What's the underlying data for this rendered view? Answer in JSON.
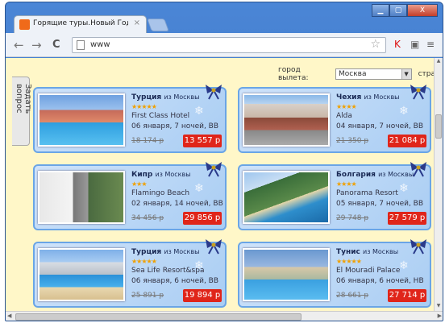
{
  "browser": {
    "tab_title": "Горящие туры.Новый Год!",
    "tab_close": "×",
    "url": "www",
    "nav": {
      "back": "←",
      "forward": "→",
      "reload": "C"
    },
    "window_controls": {
      "minimize": "▁",
      "maximize": "▢",
      "close": "X"
    }
  },
  "page": {
    "city_label": "город вылета:",
    "city_value": "Москва",
    "country_label": "стра",
    "ask_question": "Задать вопрос"
  },
  "tours": [
    {
      "country": "Турция",
      "from": "из Москвы",
      "stars": "★★★★★",
      "hotel": "First Class Hotel",
      "dates": "06 января, 7 ночей, BB",
      "old_price": "18 174 р",
      "price": "13 557 р"
    },
    {
      "country": "Чехия",
      "from": "из Москвы",
      "stars": "★★★★",
      "hotel": "Alda",
      "dates": "04 января, 7 ночей, BB",
      "old_price": "21 350 р",
      "price": "21 084 р"
    },
    {
      "country": "Кипр",
      "from": "из Москвы",
      "stars": "★★★",
      "hotel": "Flamingo Beach",
      "dates": "02 января, 14 ночей, BB",
      "old_price": "34 456 р",
      "price": "29 856 р"
    },
    {
      "country": "Болгария",
      "from": "из Москвы",
      "stars": "★★★★",
      "hotel": "Panorama Resort",
      "dates": "05 января, 7 ночей, BB",
      "old_price": "29 748 р",
      "price": "27 579 р"
    },
    {
      "country": "Турция",
      "from": "из Москвы",
      "stars": "★★★★★",
      "hotel": "Sea Life Resort&spa",
      "dates": "06 января, 6 ночей, BB",
      "old_price": "25 891 р",
      "price": "19 894 р"
    },
    {
      "country": "Тунис",
      "from": "из Москвы",
      "stars": "★★★★★",
      "hotel": "El Mouradi Palace",
      "dates": "06 января, 6 ночей, HB",
      "old_price": "28 661 р",
      "price": "27 714 р"
    }
  ],
  "colors": {
    "page_bg": "#fff7c8",
    "card_border": "#6aa5e6",
    "price_bg": "#e0251a",
    "stars": "#f0a000"
  }
}
